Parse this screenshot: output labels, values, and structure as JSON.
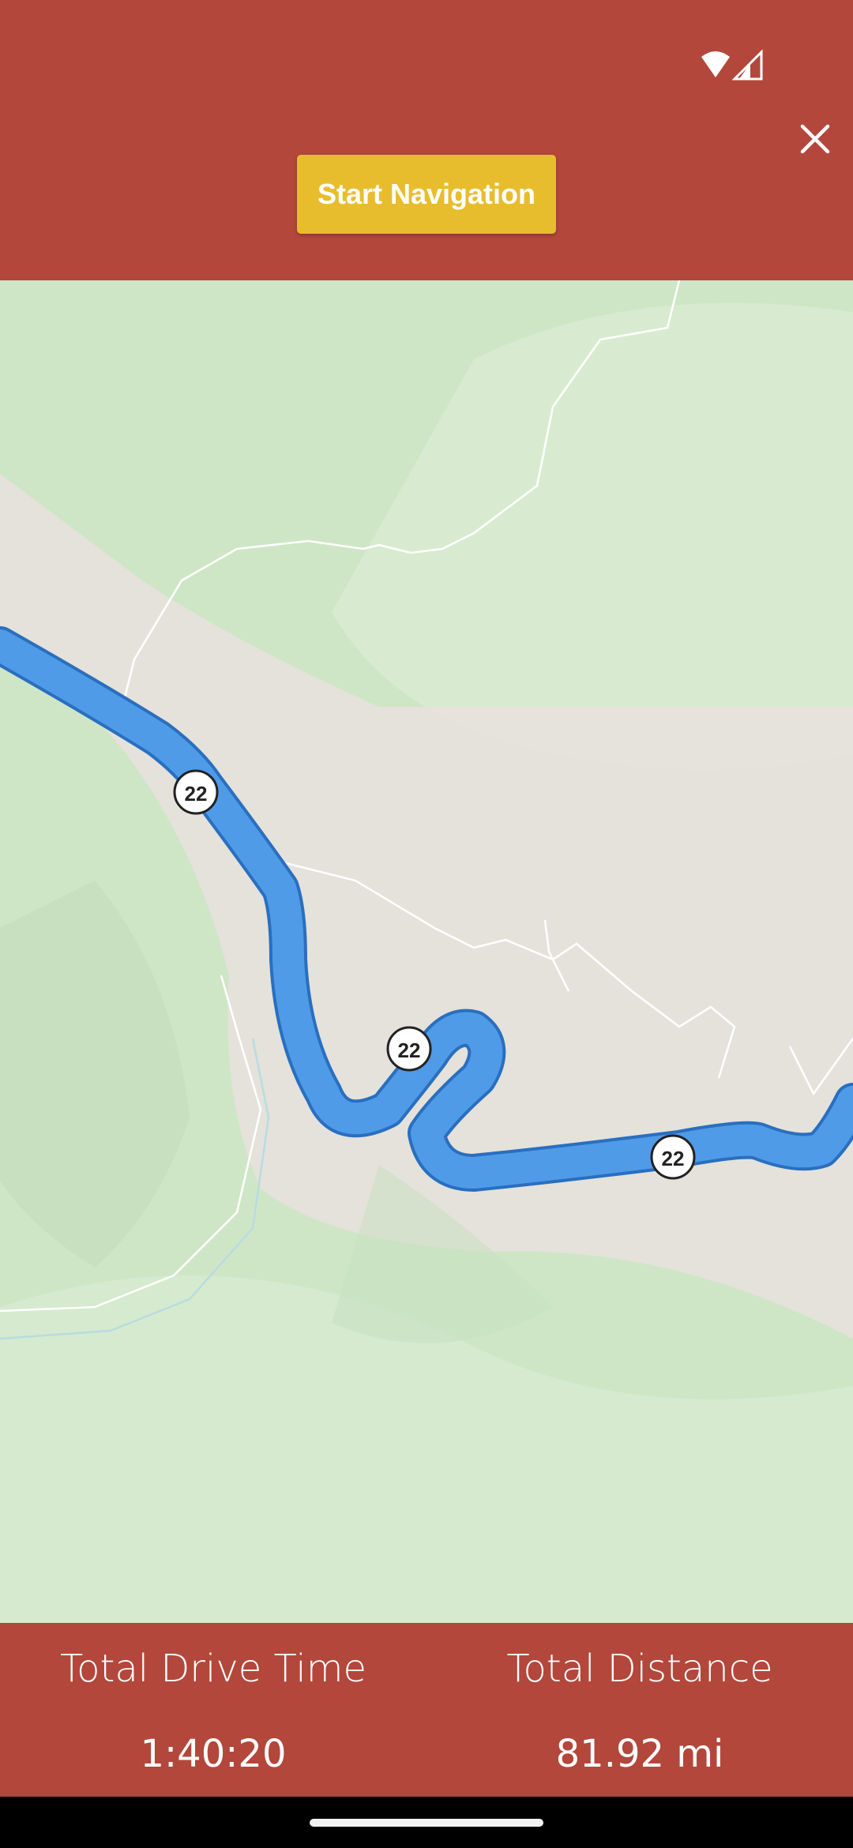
{
  "status_bar": {
    "icons": [
      "wifi-icon",
      "cell-signal-icon"
    ]
  },
  "header": {
    "start_navigation_label": "Start Navigation",
    "close_icon": "close-icon"
  },
  "map": {
    "route_shields": [
      "22",
      "22",
      "22"
    ],
    "colors": {
      "route": "#4f9be8",
      "terrain_green": "#cfe6c6",
      "valley_gray": "#e6e2dc"
    }
  },
  "footer": {
    "drive_time_label": "Total Drive Time",
    "drive_time_value": "1:40:20",
    "distance_label": "Total Distance",
    "distance_value": "81.92 mi"
  },
  "theme": {
    "bar_color": "#b3473b",
    "button_color": "#e8bd2d"
  }
}
